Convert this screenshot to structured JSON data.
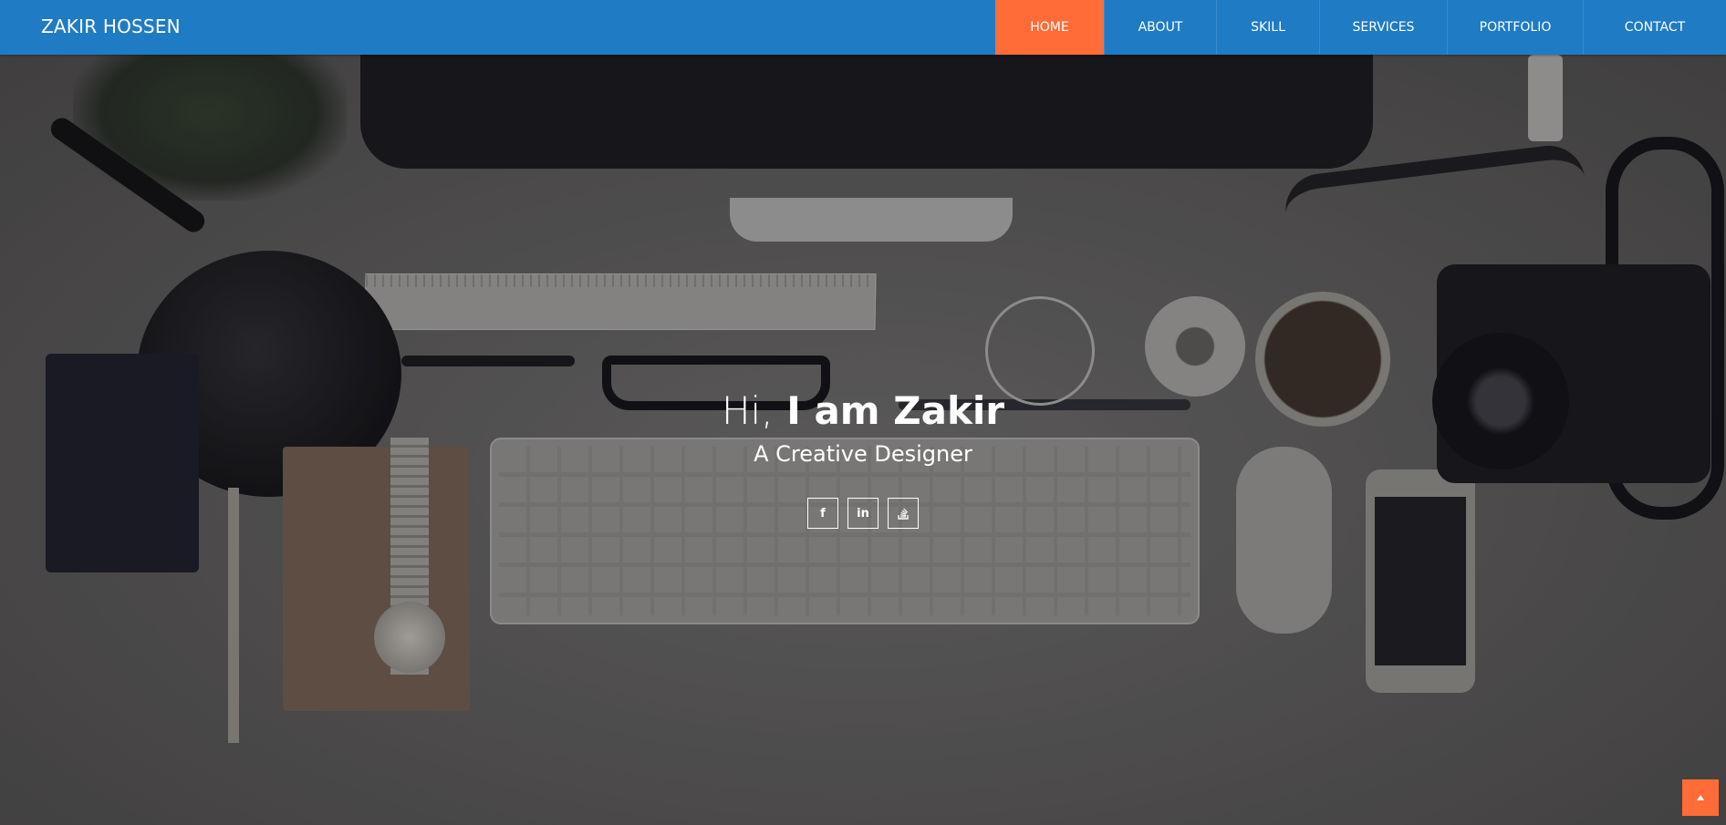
{
  "navbar": {
    "brand": "ZAKIR HOSSEN",
    "items": [
      {
        "label": "HOME",
        "active": true
      },
      {
        "label": "ABOUT",
        "active": false
      },
      {
        "label": "SKILL",
        "active": false
      },
      {
        "label": "SERVICES",
        "active": false
      },
      {
        "label": "PORTFOLIO",
        "active": false
      },
      {
        "label": "CONTACT",
        "active": false
      }
    ]
  },
  "hero": {
    "title_light": "Hi,",
    "title_bold": "I am Zakir",
    "subtitle": "A Creative Designer",
    "social": [
      {
        "icon": "facebook-icon",
        "glyph": "f"
      },
      {
        "icon": "linkedin-icon",
        "glyph": "in"
      },
      {
        "icon": "stackoverflow-icon",
        "glyph": ""
      }
    ]
  },
  "scroll_top": {
    "icon": "arrow-up-icon"
  },
  "colors": {
    "navbar": "#1f7bc4",
    "accent": "#ff6c37",
    "text": "#ffffff"
  }
}
